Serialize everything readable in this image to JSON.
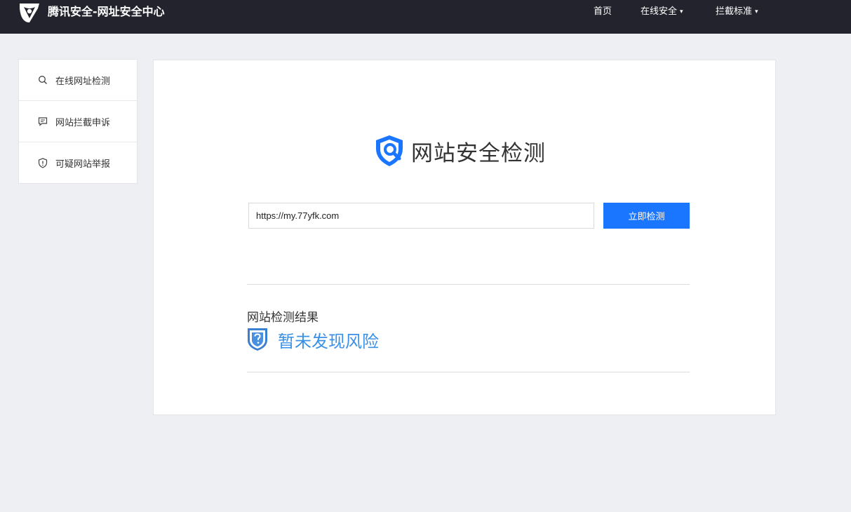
{
  "header": {
    "brand": "腾讯安全-网址安全中心",
    "logo_icon": "tencent-security-logo-icon",
    "nav": [
      {
        "label": "首页",
        "has_dropdown": false
      },
      {
        "label": "在线安全",
        "has_dropdown": true
      },
      {
        "label": "拦截标准",
        "has_dropdown": true
      }
    ],
    "caret": "▾"
  },
  "sidebar": {
    "items": [
      {
        "label": "在线网址检测",
        "icon": "search-icon"
      },
      {
        "label": "网站拦截申诉",
        "icon": "chat-icon"
      },
      {
        "label": "可疑网站举报",
        "icon": "shield-alert-icon"
      }
    ]
  },
  "main": {
    "title": "网站安全检测",
    "title_icon": "shield-search-icon",
    "url_input": {
      "value": "https://my.77yfk.com",
      "placeholder": ""
    },
    "check_button": "立即检测",
    "result_label": "网站检测结果",
    "result_status": "暂未发现风险",
    "result_icon": "shield-question-icon"
  },
  "colors": {
    "topbar": "#22232d",
    "background": "#eeeff3",
    "accent": "#1a75ff",
    "result_text": "#3a91e6"
  }
}
